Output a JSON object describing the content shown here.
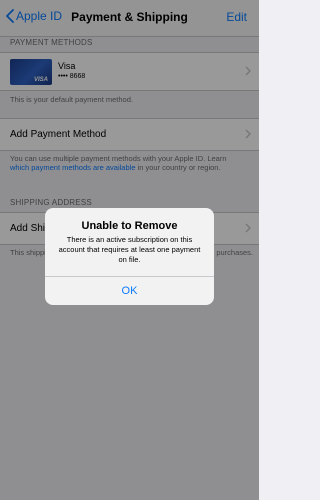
{
  "nav": {
    "back_label": "Apple ID",
    "title": "Payment & Shipping",
    "edit_label": "Edit"
  },
  "payment_methods": {
    "header": "PAYMENT METHODS",
    "card": {
      "brand_on_art": "VISA",
      "name": "Visa",
      "number": "•••• 8668"
    },
    "default_note": "This is your default payment method.",
    "add_label": "Add Payment Method",
    "footer_part1": "You can use multiple payment methods with your Apple ID. Learn ",
    "footer_link": "which payment methods are available",
    "footer_part2": " in your country or region."
  },
  "shipping": {
    "header": "SHIPPING ADDRESS",
    "add_label": "Add Shipping Address",
    "footer_left": "This shipping",
    "footer_right": "purchases."
  },
  "alert": {
    "title": "Unable to Remove",
    "message": "There is an active subscription on this account that requires at least one payment on file.",
    "ok_label": "OK"
  },
  "colors": {
    "accent": "#0a7aff",
    "background": "#efeff4"
  }
}
